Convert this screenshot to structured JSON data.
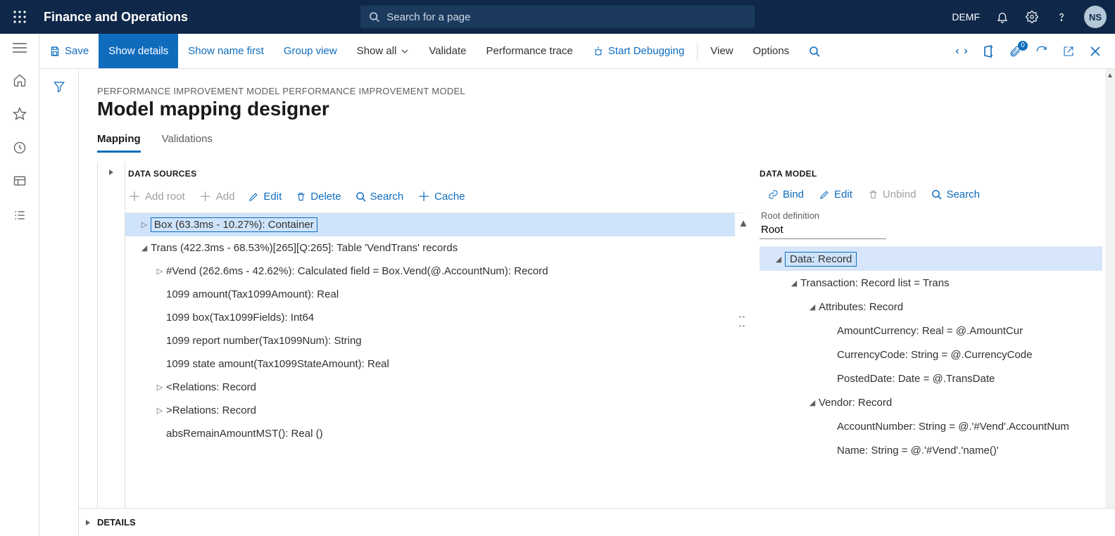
{
  "app_title": "Finance and Operations",
  "search_placeholder": "Search for a page",
  "company": "DEMF",
  "avatar": "NS",
  "cmd": {
    "save": "Save",
    "show_details": "Show details",
    "show_name_first": "Show name first",
    "group_view": "Group view",
    "show_all": "Show all",
    "validate": "Validate",
    "perf_trace": "Performance trace",
    "start_debug": "Start Debugging",
    "view": "View",
    "options": "Options",
    "attach_badge": "0"
  },
  "breadcrumb": "PERFORMANCE IMPROVEMENT MODEL PERFORMANCE IMPROVEMENT MODEL",
  "page_title": "Model mapping designer",
  "tabs": {
    "mapping": "Mapping",
    "validations": "Validations"
  },
  "ds": {
    "header": "DATA SOURCES",
    "add_root": "Add root",
    "add": "Add",
    "edit": "Edit",
    "delete": "Delete",
    "search": "Search",
    "cache": "Cache",
    "nodes": [
      "Box (63.3ms - 10.27%): Container",
      "Trans (422.3ms - 68.53%)[265][Q:265]: Table 'VendTrans' records",
      "#Vend (262.6ms - 42.62%): Calculated field = Box.Vend(@.AccountNum): Record",
      "1099 amount(Tax1099Amount): Real",
      "1099 box(Tax1099Fields): Int64",
      "1099 report number(Tax1099Num): String",
      "1099 state amount(Tax1099StateAmount): Real",
      "<Relations: Record",
      ">Relations: Record",
      "absRemainAmountMST(): Real ()"
    ]
  },
  "dm": {
    "header": "DATA MODEL",
    "bind": "Bind",
    "edit": "Edit",
    "unbind": "Unbind",
    "search": "Search",
    "root_lbl": "Root definition",
    "root_val": "Root",
    "nodes": [
      "Data: Record",
      "Transaction: Record list = Trans",
      "Attributes: Record",
      "AmountCurrency: Real = @.AmountCur",
      "CurrencyCode: String = @.CurrencyCode",
      "PostedDate: Date = @.TransDate",
      "Vendor: Record",
      "AccountNumber: String = @.'#Vend'.AccountNum",
      "Name: String = @.'#Vend'.'name()'"
    ]
  },
  "details": "DETAILS"
}
